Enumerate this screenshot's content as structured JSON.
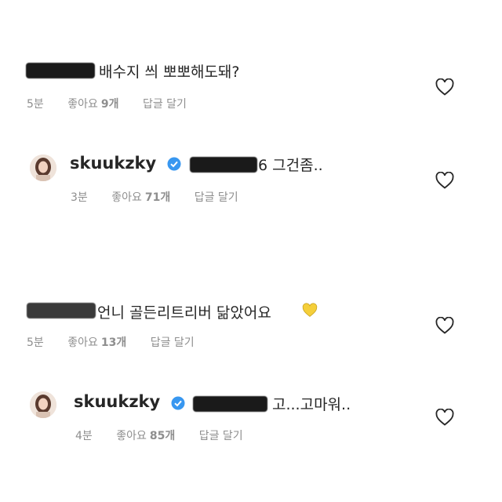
{
  "comments": [
    {
      "text": "배수지 씌 뽀뽀해도돼?",
      "time": "5분",
      "likes_label": "좋아요",
      "likes_count": "9개",
      "reply": "답글 달기"
    },
    {
      "username": "skuukzky",
      "text": "6 그건좀..",
      "time": "3분",
      "likes_label": "좋아요",
      "likes_count": "71개",
      "reply": "답글 달기"
    },
    {
      "text": "언니 골든리트리버 닮았어요",
      "emoji": "yellow-heart",
      "time": "5분",
      "likes_label": "좋아요",
      "likes_count": "13개",
      "reply": "답글 달기"
    },
    {
      "username": "skuukzky",
      "text": "고...고마워..",
      "time": "4분",
      "likes_label": "좋아요",
      "likes_count": "85개",
      "reply": "답글 달기"
    }
  ],
  "icons": {
    "like": "heart-outline-icon",
    "verified": "verified-badge-icon",
    "emoji": "yellow-heart-icon"
  },
  "colors": {
    "verified": "#3897f0",
    "meta_text": "#8e8e8e",
    "emoji_heart": "#f5cf3a"
  }
}
